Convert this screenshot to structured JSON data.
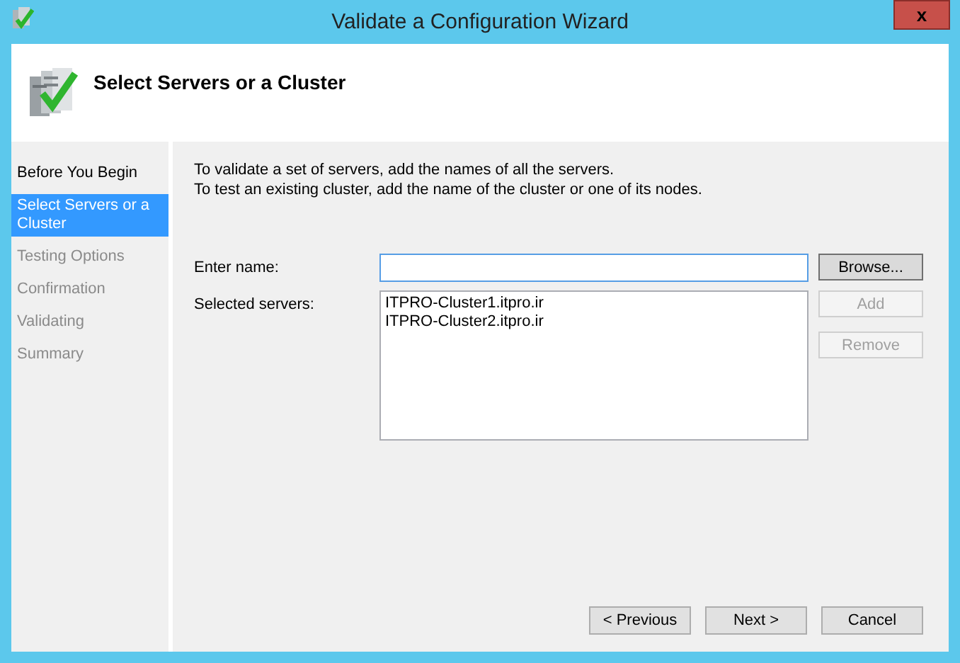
{
  "window": {
    "title": "Validate a Configuration Wizard",
    "close": "x"
  },
  "header": {
    "title": "Select Servers or a Cluster"
  },
  "steps": [
    {
      "label": "Before You Begin",
      "selected": false,
      "disabled": false
    },
    {
      "label": "Select Servers or a Cluster",
      "selected": true,
      "disabled": false
    },
    {
      "label": "Testing Options",
      "selected": false,
      "disabled": true
    },
    {
      "label": "Confirmation",
      "selected": false,
      "disabled": true
    },
    {
      "label": "Validating",
      "selected": false,
      "disabled": true
    },
    {
      "label": "Summary",
      "selected": false,
      "disabled": true
    }
  ],
  "instructions": [
    "To validate a set of servers, add the names of all the servers.",
    "To test an existing cluster, add the name of the cluster or one of its nodes."
  ],
  "enter_name": {
    "label": "Enter name:",
    "button": {
      "label": "Browse...",
      "disabled": false
    }
  },
  "selected_servers": {
    "label": "Selected servers:",
    "items": [
      "ITPRO-Cluster1.itpro.ir",
      "ITPRO-Cluster2.itpro.ir"
    ],
    "buttons": [
      {
        "label": "Add",
        "disabled": true
      },
      {
        "label": "Remove",
        "disabled": true
      }
    ]
  },
  "footer_buttons": [
    {
      "label": "< Previous",
      "disabled": false
    },
    {
      "label": "Next >",
      "disabled": false
    },
    {
      "label": "Cancel",
      "disabled": false
    }
  ]
}
